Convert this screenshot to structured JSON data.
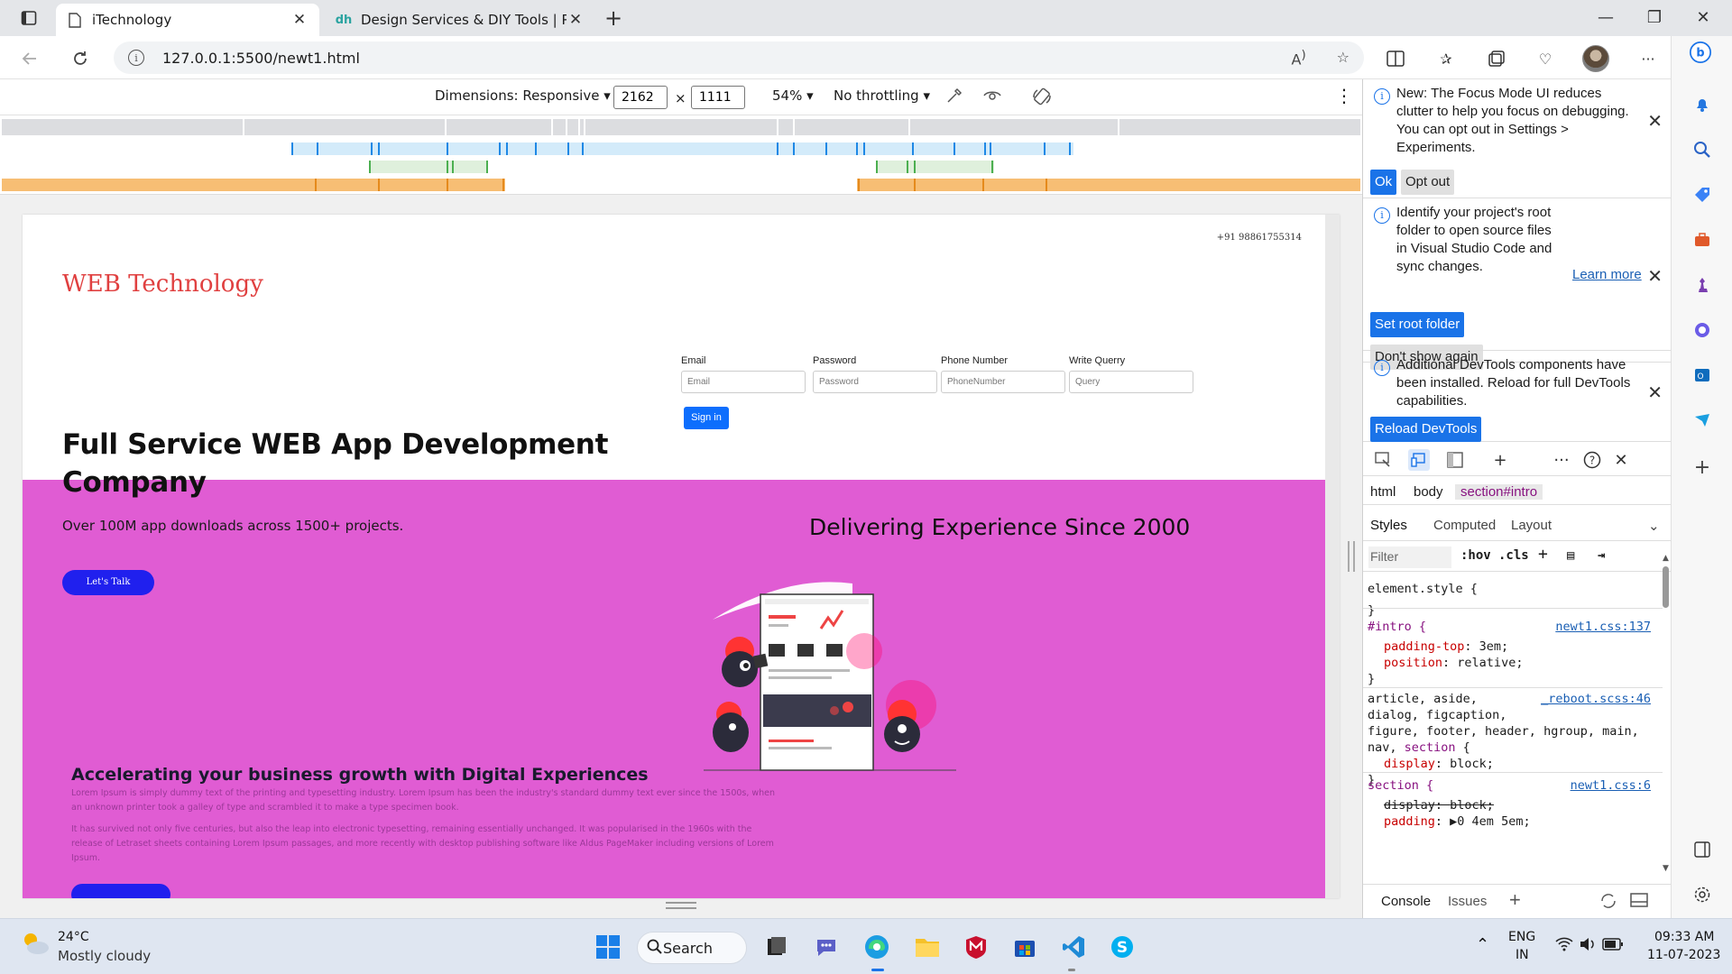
{
  "browser": {
    "tabs": [
      {
        "title": "iTechnology",
        "active": true
      },
      {
        "title": "Design Services & DIY Tools | Pri",
        "active": false
      }
    ],
    "url": "127.0.0.1:5500/newt1.html",
    "window_controls": [
      "minimize",
      "maximize",
      "close"
    ]
  },
  "device_toolbar": {
    "dimensions_label": "Dimensions: Responsive",
    "width": "2162",
    "times": "×",
    "height": "1111",
    "zoom": "54%",
    "throttling": "No throttling"
  },
  "site": {
    "phone": "+91 98861755314",
    "logo": "WEB Technology",
    "form": {
      "fields": [
        {
          "label": "Email",
          "placeholder": "Email"
        },
        {
          "label": "Password",
          "placeholder": "Password"
        },
        {
          "label": "Phone Number",
          "placeholder": "PhoneNumber"
        },
        {
          "label": "Write Querry",
          "placeholder": "Query"
        }
      ],
      "submit": "Sign in"
    },
    "hero_title": "Full Service WEB App Development Company",
    "intro": {
      "subtitle": "Over 100M app downloads across 1500+ projects.",
      "cta": "Let's Talk",
      "since": "Delivering Experience Since 2000",
      "growth_title": "Accelerating your business growth with Digital Experiences",
      "para1": "Lorem Ipsum is simply dummy text of the printing and typesetting industry. Lorem Ipsum has been the industry's standard dummy text ever since the 1500s, when an unknown printer took a galley of type and scrambled it to make a type specimen book.",
      "para2": "It has survived not only five centuries, but also the leap into electronic typesetting, remaining essentially unchanged. It was popularised in the 1960s with the release of Letraset sheets containing Lorem Ipsum passages, and more recently with desktop publishing software like Aldus PageMaker including versions of Lorem Ipsum.",
      "bg_color": "#e05cd3"
    }
  },
  "devtools": {
    "notices": [
      {
        "text": "New: The Focus Mode UI reduces clutter to help you focus on debugging. You can opt out in Settings > Experiments.",
        "buttons": [
          "Ok",
          "Opt out"
        ]
      },
      {
        "text": "Identify your project's root folder to open source files in Visual Studio Code and sync changes.",
        "link": "Learn more",
        "buttons": [
          "Set root folder",
          "Don't show again"
        ]
      },
      {
        "text": "Additional DevTools components have been installed. Reload for full DevTools capabilities.",
        "buttons": [
          "Reload DevTools"
        ]
      }
    ],
    "breadcrumbs": [
      "html",
      "body",
      "section#intro"
    ],
    "subtabs": [
      "Styles",
      "Computed",
      "Layout"
    ],
    "filter_placeholder": "Filter",
    "hov": ":hov",
    "cls": ".cls",
    "rules": [
      {
        "selector": "element.style {",
        "lines": [],
        "close": "}",
        "source": ""
      },
      {
        "selector": "#intro {",
        "lines": [
          {
            "p": "padding-top",
            "v": "3em;"
          },
          {
            "p": "position",
            "v": "relative;"
          }
        ],
        "close": "}",
        "source": "newt1.css:137"
      },
      {
        "selector": "article, aside,",
        "extra": [
          "dialog, figcaption,",
          "figure, footer, header, hgroup, main,",
          "nav, section {"
        ],
        "lines": [
          {
            "p": "display",
            "v": "block;"
          }
        ],
        "close": "}",
        "source": "_reboot.scss:46"
      },
      {
        "selector": "section {",
        "lines": [
          {
            "p": "display",
            "v": "block;",
            "struck": true
          },
          {
            "p": "padding",
            "v": "▶0 4em 5em;"
          }
        ],
        "close": "",
        "source": "newt1.css:6"
      }
    ],
    "drawer_tabs": [
      "Console",
      "Issues"
    ],
    "accent": "#1a73e8"
  },
  "taskbar": {
    "weather_temp": "24°C",
    "weather_desc": "Mostly cloudy",
    "search_label": "Search",
    "lang": "ENG",
    "region": "IN",
    "time": "09:33 AM",
    "date": "11-07-2023"
  }
}
